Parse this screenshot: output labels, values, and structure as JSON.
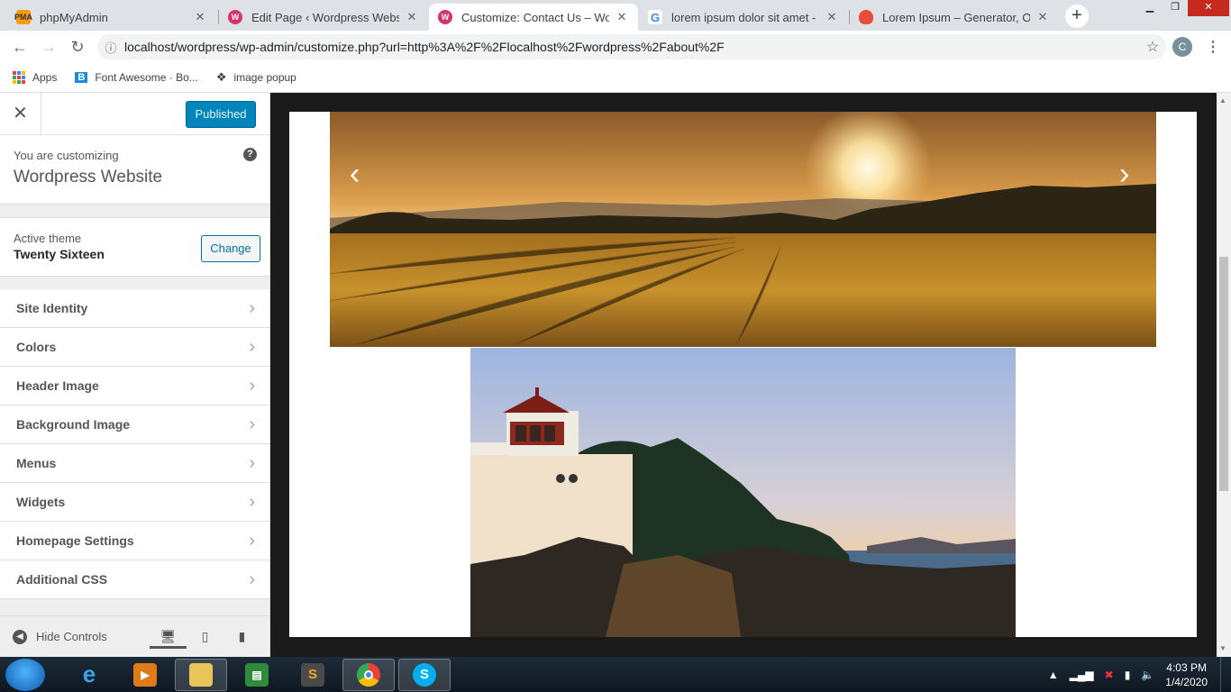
{
  "browser": {
    "tabs": [
      {
        "title": "phpMyAdmin",
        "favicon": "phpmyadmin-icon",
        "active": false
      },
      {
        "title": "Edit Page ‹ Wordpress Website",
        "favicon": "wordpress-icon",
        "active": false
      },
      {
        "title": "Customize: Contact Us – WordP",
        "favicon": "wordpress-icon",
        "active": true
      },
      {
        "title": "lorem ipsum dolor sit amet - Go",
        "favicon": "google-icon",
        "active": false
      },
      {
        "title": "Lorem Ipsum – Generator, Origi",
        "favicon": "lipsum-icon",
        "active": false
      }
    ],
    "new_tab": "+",
    "url": "localhost/wordpress/wp-admin/customize.php?url=http%3A%2F%2Flocalhost%2Fwordpress%2Fabout%2F",
    "profile_initial": "C",
    "bookmarks": [
      {
        "label": "Apps",
        "icon": "apps-grid-icon"
      },
      {
        "label": "Font Awesome · Bo...",
        "icon": "bootstrap-icon"
      },
      {
        "label": "image popup",
        "icon": "codepen-icon"
      }
    ]
  },
  "customizer": {
    "close": "✕",
    "publish_label": "Published",
    "customizing_label": "You are customizing",
    "site_name": "Wordpress Website",
    "help": "?",
    "active_theme_label": "Active theme",
    "theme_name": "Twenty Sixteen",
    "change_label": "Change",
    "sections": [
      {
        "label": "Site Identity"
      },
      {
        "label": "Colors"
      },
      {
        "label": "Header Image"
      },
      {
        "label": "Background Image"
      },
      {
        "label": "Menus"
      },
      {
        "label": "Widgets"
      },
      {
        "label": "Homepage Settings"
      },
      {
        "label": "Additional CSS"
      }
    ],
    "hide_controls_label": "Hide Controls",
    "devices": [
      "desktop-icon",
      "tablet-icon",
      "mobile-icon"
    ]
  },
  "preview": {
    "slider_prev": "‹",
    "slider_next": "›"
  },
  "taskbar": {
    "apps": [
      "internet-explorer-icon",
      "media-player-icon",
      "file-explorer-icon",
      "spreadsheet-icon",
      "sublime-text-icon",
      "chrome-icon",
      "skype-icon"
    ],
    "time": "4:03 PM",
    "date": "1/4/2020"
  },
  "colors": {
    "publish_bg": "#0085ba",
    "link_blue": "#0073aa",
    "preview_frame": "#1a1a1a"
  }
}
